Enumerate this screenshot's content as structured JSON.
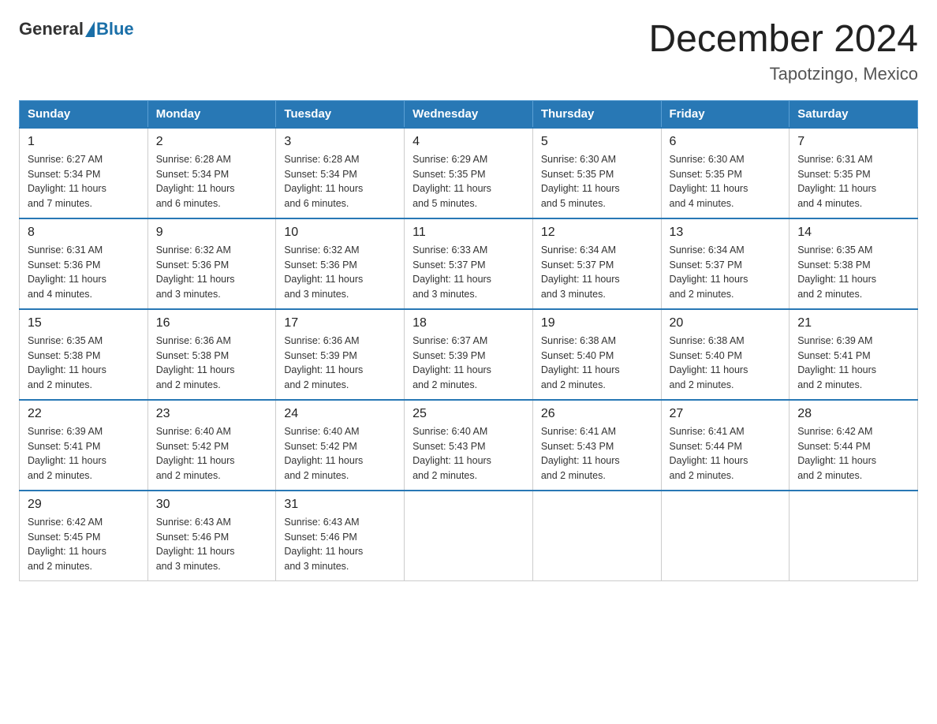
{
  "header": {
    "logo_general": "General",
    "logo_blue": "Blue",
    "month_title": "December 2024",
    "location": "Tapotzingo, Mexico"
  },
  "days_of_week": [
    "Sunday",
    "Monday",
    "Tuesday",
    "Wednesday",
    "Thursday",
    "Friday",
    "Saturday"
  ],
  "weeks": [
    [
      {
        "day": "1",
        "sunrise": "6:27 AM",
        "sunset": "5:34 PM",
        "daylight": "11 hours and 7 minutes."
      },
      {
        "day": "2",
        "sunrise": "6:28 AM",
        "sunset": "5:34 PM",
        "daylight": "11 hours and 6 minutes."
      },
      {
        "day": "3",
        "sunrise": "6:28 AM",
        "sunset": "5:34 PM",
        "daylight": "11 hours and 6 minutes."
      },
      {
        "day": "4",
        "sunrise": "6:29 AM",
        "sunset": "5:35 PM",
        "daylight": "11 hours and 5 minutes."
      },
      {
        "day": "5",
        "sunrise": "6:30 AM",
        "sunset": "5:35 PM",
        "daylight": "11 hours and 5 minutes."
      },
      {
        "day": "6",
        "sunrise": "6:30 AM",
        "sunset": "5:35 PM",
        "daylight": "11 hours and 4 minutes."
      },
      {
        "day": "7",
        "sunrise": "6:31 AM",
        "sunset": "5:35 PM",
        "daylight": "11 hours and 4 minutes."
      }
    ],
    [
      {
        "day": "8",
        "sunrise": "6:31 AM",
        "sunset": "5:36 PM",
        "daylight": "11 hours and 4 minutes."
      },
      {
        "day": "9",
        "sunrise": "6:32 AM",
        "sunset": "5:36 PM",
        "daylight": "11 hours and 3 minutes."
      },
      {
        "day": "10",
        "sunrise": "6:32 AM",
        "sunset": "5:36 PM",
        "daylight": "11 hours and 3 minutes."
      },
      {
        "day": "11",
        "sunrise": "6:33 AM",
        "sunset": "5:37 PM",
        "daylight": "11 hours and 3 minutes."
      },
      {
        "day": "12",
        "sunrise": "6:34 AM",
        "sunset": "5:37 PM",
        "daylight": "11 hours and 3 minutes."
      },
      {
        "day": "13",
        "sunrise": "6:34 AM",
        "sunset": "5:37 PM",
        "daylight": "11 hours and 2 minutes."
      },
      {
        "day": "14",
        "sunrise": "6:35 AM",
        "sunset": "5:38 PM",
        "daylight": "11 hours and 2 minutes."
      }
    ],
    [
      {
        "day": "15",
        "sunrise": "6:35 AM",
        "sunset": "5:38 PM",
        "daylight": "11 hours and 2 minutes."
      },
      {
        "day": "16",
        "sunrise": "6:36 AM",
        "sunset": "5:38 PM",
        "daylight": "11 hours and 2 minutes."
      },
      {
        "day": "17",
        "sunrise": "6:36 AM",
        "sunset": "5:39 PM",
        "daylight": "11 hours and 2 minutes."
      },
      {
        "day": "18",
        "sunrise": "6:37 AM",
        "sunset": "5:39 PM",
        "daylight": "11 hours and 2 minutes."
      },
      {
        "day": "19",
        "sunrise": "6:38 AM",
        "sunset": "5:40 PM",
        "daylight": "11 hours and 2 minutes."
      },
      {
        "day": "20",
        "sunrise": "6:38 AM",
        "sunset": "5:40 PM",
        "daylight": "11 hours and 2 minutes."
      },
      {
        "day": "21",
        "sunrise": "6:39 AM",
        "sunset": "5:41 PM",
        "daylight": "11 hours and 2 minutes."
      }
    ],
    [
      {
        "day": "22",
        "sunrise": "6:39 AM",
        "sunset": "5:41 PM",
        "daylight": "11 hours and 2 minutes."
      },
      {
        "day": "23",
        "sunrise": "6:40 AM",
        "sunset": "5:42 PM",
        "daylight": "11 hours and 2 minutes."
      },
      {
        "day": "24",
        "sunrise": "6:40 AM",
        "sunset": "5:42 PM",
        "daylight": "11 hours and 2 minutes."
      },
      {
        "day": "25",
        "sunrise": "6:40 AM",
        "sunset": "5:43 PM",
        "daylight": "11 hours and 2 minutes."
      },
      {
        "day": "26",
        "sunrise": "6:41 AM",
        "sunset": "5:43 PM",
        "daylight": "11 hours and 2 minutes."
      },
      {
        "day": "27",
        "sunrise": "6:41 AM",
        "sunset": "5:44 PM",
        "daylight": "11 hours and 2 minutes."
      },
      {
        "day": "28",
        "sunrise": "6:42 AM",
        "sunset": "5:44 PM",
        "daylight": "11 hours and 2 minutes."
      }
    ],
    [
      {
        "day": "29",
        "sunrise": "6:42 AM",
        "sunset": "5:45 PM",
        "daylight": "11 hours and 2 minutes."
      },
      {
        "day": "30",
        "sunrise": "6:43 AM",
        "sunset": "5:46 PM",
        "daylight": "11 hours and 3 minutes."
      },
      {
        "day": "31",
        "sunrise": "6:43 AM",
        "sunset": "5:46 PM",
        "daylight": "11 hours and 3 minutes."
      },
      null,
      null,
      null,
      null
    ]
  ],
  "labels": {
    "sunrise": "Sunrise:",
    "sunset": "Sunset:",
    "daylight": "Daylight:"
  }
}
